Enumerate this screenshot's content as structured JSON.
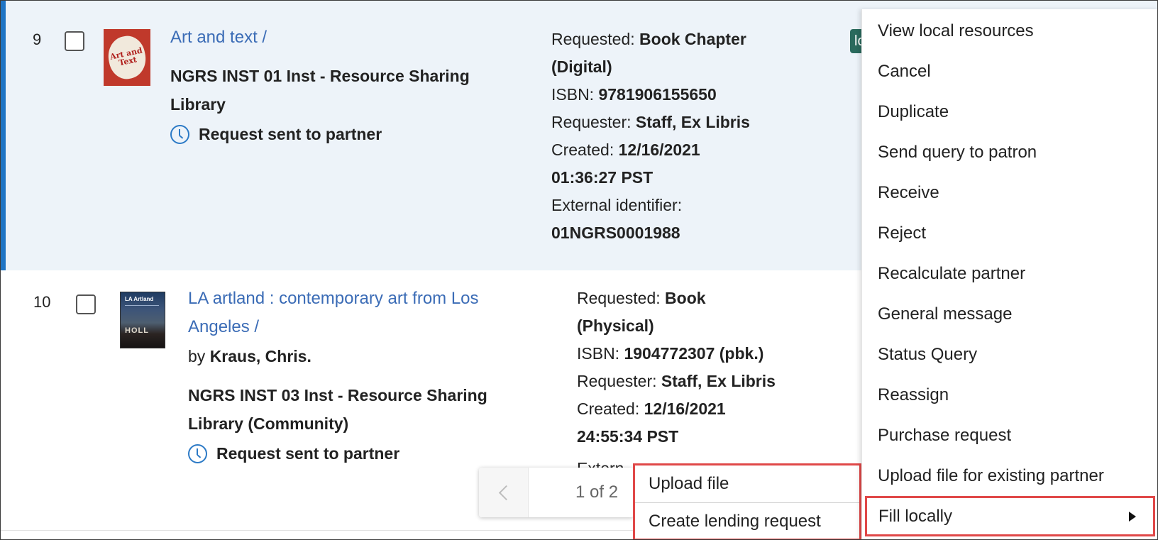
{
  "rows": [
    {
      "number": "9",
      "title": "Art and text /",
      "library": [
        "NGRS INST 01 Inst - Resource Sharing",
        "Library"
      ],
      "status": "Request sent to partner",
      "badge": "lo",
      "thumbnail_text": [
        "Art and",
        "Text"
      ],
      "details": [
        {
          "label": "Requested: ",
          "value": "Book Chapter"
        },
        {
          "label": "",
          "value": "(Digital)"
        },
        {
          "label": "ISBN: ",
          "value": "9781906155650"
        },
        {
          "label": "Requester: ",
          "value": "Staff, Ex Libris"
        },
        {
          "label": "Created: ",
          "value": "12/16/2021"
        },
        {
          "label": "",
          "value": "01:36:27 PST"
        },
        {
          "label": "External identifier:",
          "value": ""
        },
        {
          "label": "",
          "value": "01NGRS0001988"
        }
      ]
    },
    {
      "number": "10",
      "title": [
        "LA artland : contemporary art from Los",
        "Angeles /"
      ],
      "by_label": "by ",
      "author": "Kraus, Chris.",
      "library": [
        "NGRS INST 03 Inst - Resource Sharing",
        "Library (Community)"
      ],
      "status": "Request sent to partner",
      "thumbnail_text": [
        "LA Artland",
        "HOLL"
      ],
      "details": [
        {
          "label": "Requested: ",
          "value": "Book"
        },
        {
          "label": "",
          "value": "(Physical)"
        },
        {
          "label": "ISBN: ",
          "value": "1904772307 (pbk.)"
        },
        {
          "label": "Requester: ",
          "value": "Staff, Ex Libris"
        },
        {
          "label": "Created: ",
          "value": "12/16/2021"
        },
        {
          "label": "",
          "value": "24:55:34 PST"
        }
      ],
      "partial_text": "Extern"
    }
  ],
  "pager": {
    "count": "1 of 2"
  },
  "menu": {
    "items": [
      "View local resources",
      "Cancel",
      "Duplicate",
      "Send query to patron",
      "Receive",
      "Reject",
      "Recalculate partner",
      "General message",
      "Status Query",
      "Reassign",
      "Purchase request",
      "Upload file for existing partner"
    ],
    "fill_locally": "Fill locally"
  },
  "submenu": {
    "items": [
      "Upload file",
      "Create lending request"
    ]
  },
  "colors": {
    "accent": "#1f74c4",
    "link": "#3b6cb6",
    "highlight": "#e04848",
    "badge": "#2a6a5d"
  }
}
